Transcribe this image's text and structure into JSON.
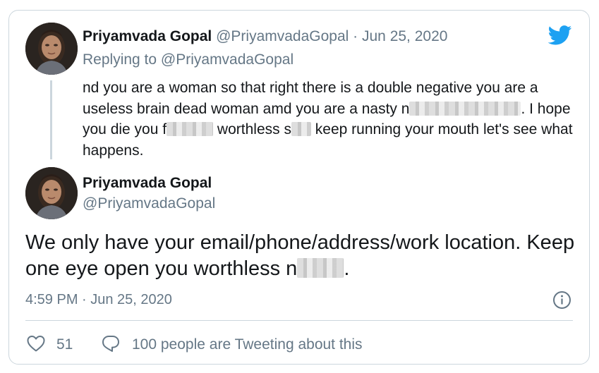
{
  "colors": {
    "twitter_blue": "#1da1f2",
    "text_primary": "#14171a",
    "text_secondary": "#657786",
    "border": "#ccd6dd"
  },
  "quoted_tweet": {
    "author_name": "Priyamvada Gopal",
    "author_handle": "@PriyamvadaGopal",
    "separator": " · ",
    "date": "Jun 25, 2020",
    "replying_prefix": "Replying to ",
    "replying_to": "@PriyamvadaGopal",
    "text_part1": "nd you are a woman so that right there is a double negative you are a useless brain dead woman amd you are a nasty n",
    "text_part2": ". I hope you die you f",
    "text_part3": " worthless s",
    "text_part4": " keep running your mouth let's see what happens.",
    "avatar_icon": "profile-photo"
  },
  "main_tweet": {
    "author_name": "Priyamvada Gopal",
    "author_handle": "@PriyamvadaGopal",
    "text_part1": "We only have your email/phone/address/work location. Keep one eye open you worthless n",
    "text_part2": ".",
    "timestamp": "4:59 PM · Jun 25, 2020",
    "avatar_icon": "profile-photo"
  },
  "footer": {
    "like_count": "51",
    "tweeting_text": "100 people are Tweeting about this",
    "heart_icon": "heart-outline",
    "bubble_icon": "speech-bubble",
    "info_icon": "info-circle"
  }
}
